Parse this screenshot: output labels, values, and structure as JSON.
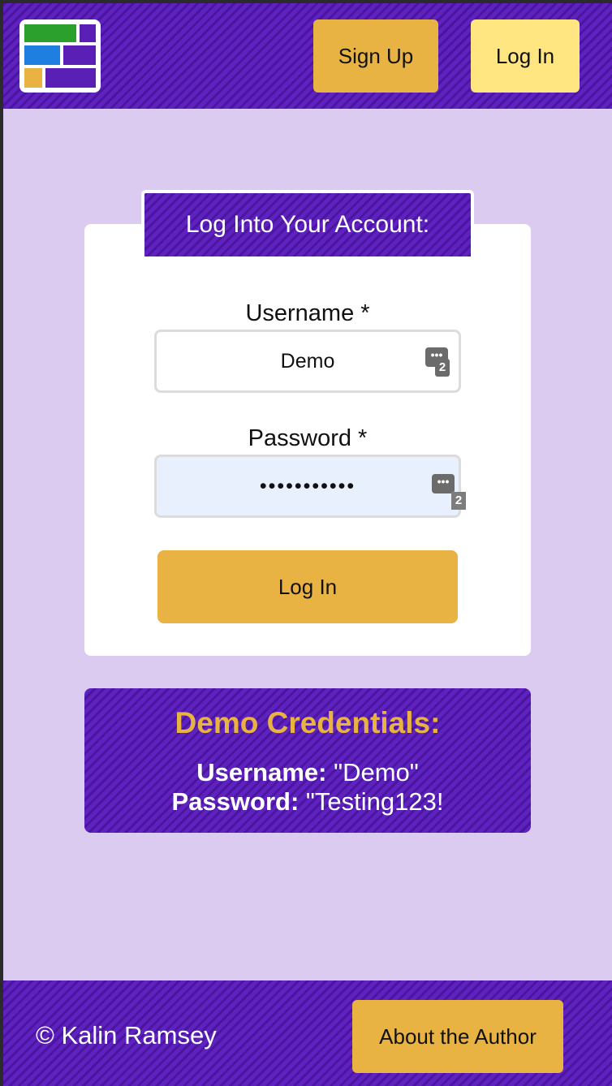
{
  "header": {
    "logo_icon": "grid-logo-icon",
    "signup_label": "Sign Up",
    "login_label": "Log In"
  },
  "login_form": {
    "title": "Log Into Your Account:",
    "username_label": "Username *",
    "username_value": "Demo",
    "password_label": "Password *",
    "password_value": "Testing123!",
    "password_manager_count": "2",
    "submit_label": "Log In"
  },
  "demo": {
    "title": "Demo Credentials:",
    "username_key": "Username:",
    "username_val": " \"Demo\"",
    "password_key": "Password:",
    "password_val": " \"Testing123!"
  },
  "footer": {
    "copyright": "© Kalin Ramsey",
    "about_label": "About the Author"
  },
  "colors": {
    "brand_purple": "#5a1fb5",
    "accent_gold": "#e8b343",
    "pale_yellow": "#ffe680",
    "background_lavender": "#dccbf0"
  }
}
